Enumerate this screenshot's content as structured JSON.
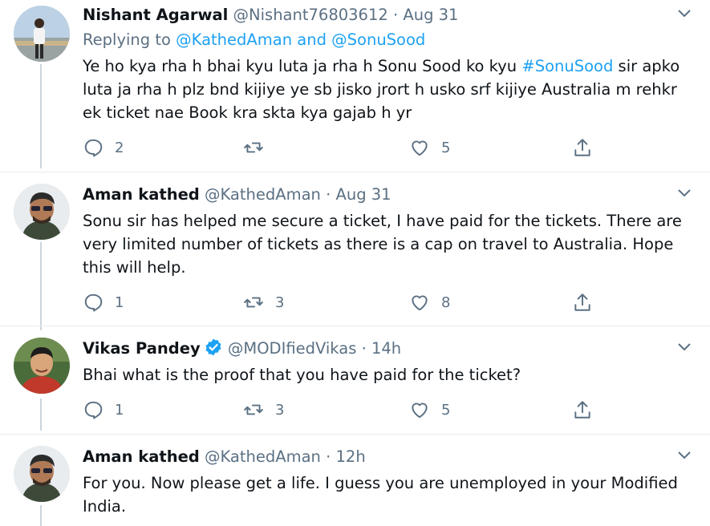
{
  "tweets": [
    {
      "name": "Nishant Agarwal",
      "handle": "@Nishant76803612",
      "sep": "·",
      "time": "Aug 31",
      "replying_prefix": "Replying to",
      "replying_user1": "@KathedAman",
      "replying_and": "and",
      "replying_user2": "@SonuSood",
      "text_before": "Ye ho kya rha h bhai kyu luta ja rha h Sonu Sood ko kyu ",
      "hashtag": "#SonuSood",
      "text_after": " sir apko luta ja rha h plz bnd kijiye ye sb jisko jrort h usko srf kijiye Australia m rehkr ek ticket nae Book kra skta kya gajab h yr",
      "replies": "2",
      "retweets": "",
      "likes": "5"
    },
    {
      "name": "Aman kathed",
      "handle": "@KathedAman",
      "sep": "·",
      "time": "Aug 31",
      "text": "Sonu sir has helped me secure a ticket, I have paid for the tickets. There are very limited number of tickets as there is a cap on travel to Australia. Hope this will help.",
      "replies": "1",
      "retweets": "3",
      "likes": "8"
    },
    {
      "name": "Vikas Pandey",
      "handle": "@MODIfiedVikas",
      "sep": "·",
      "time": "14h",
      "text": "Bhai what is the proof that you have paid for the ticket?",
      "replies": "1",
      "retweets": "3",
      "likes": "5"
    },
    {
      "name": "Aman kathed",
      "handle": "@KathedAman",
      "sep": "·",
      "time": "12h",
      "text": "For you. Now please get a life. I guess you are unemployed in your Modified India."
    }
  ],
  "icons": {
    "reply": "reply-icon",
    "retweet": "retweet-icon",
    "like": "heart-icon",
    "share": "share-icon",
    "more": "chevron-down-icon",
    "verified": "verified-badge-icon"
  },
  "colors": {
    "link": "#1da1f2",
    "secondary_text": "#5b7083",
    "separator": "#e6ecf0",
    "thread_line": "#ccd6dd"
  }
}
